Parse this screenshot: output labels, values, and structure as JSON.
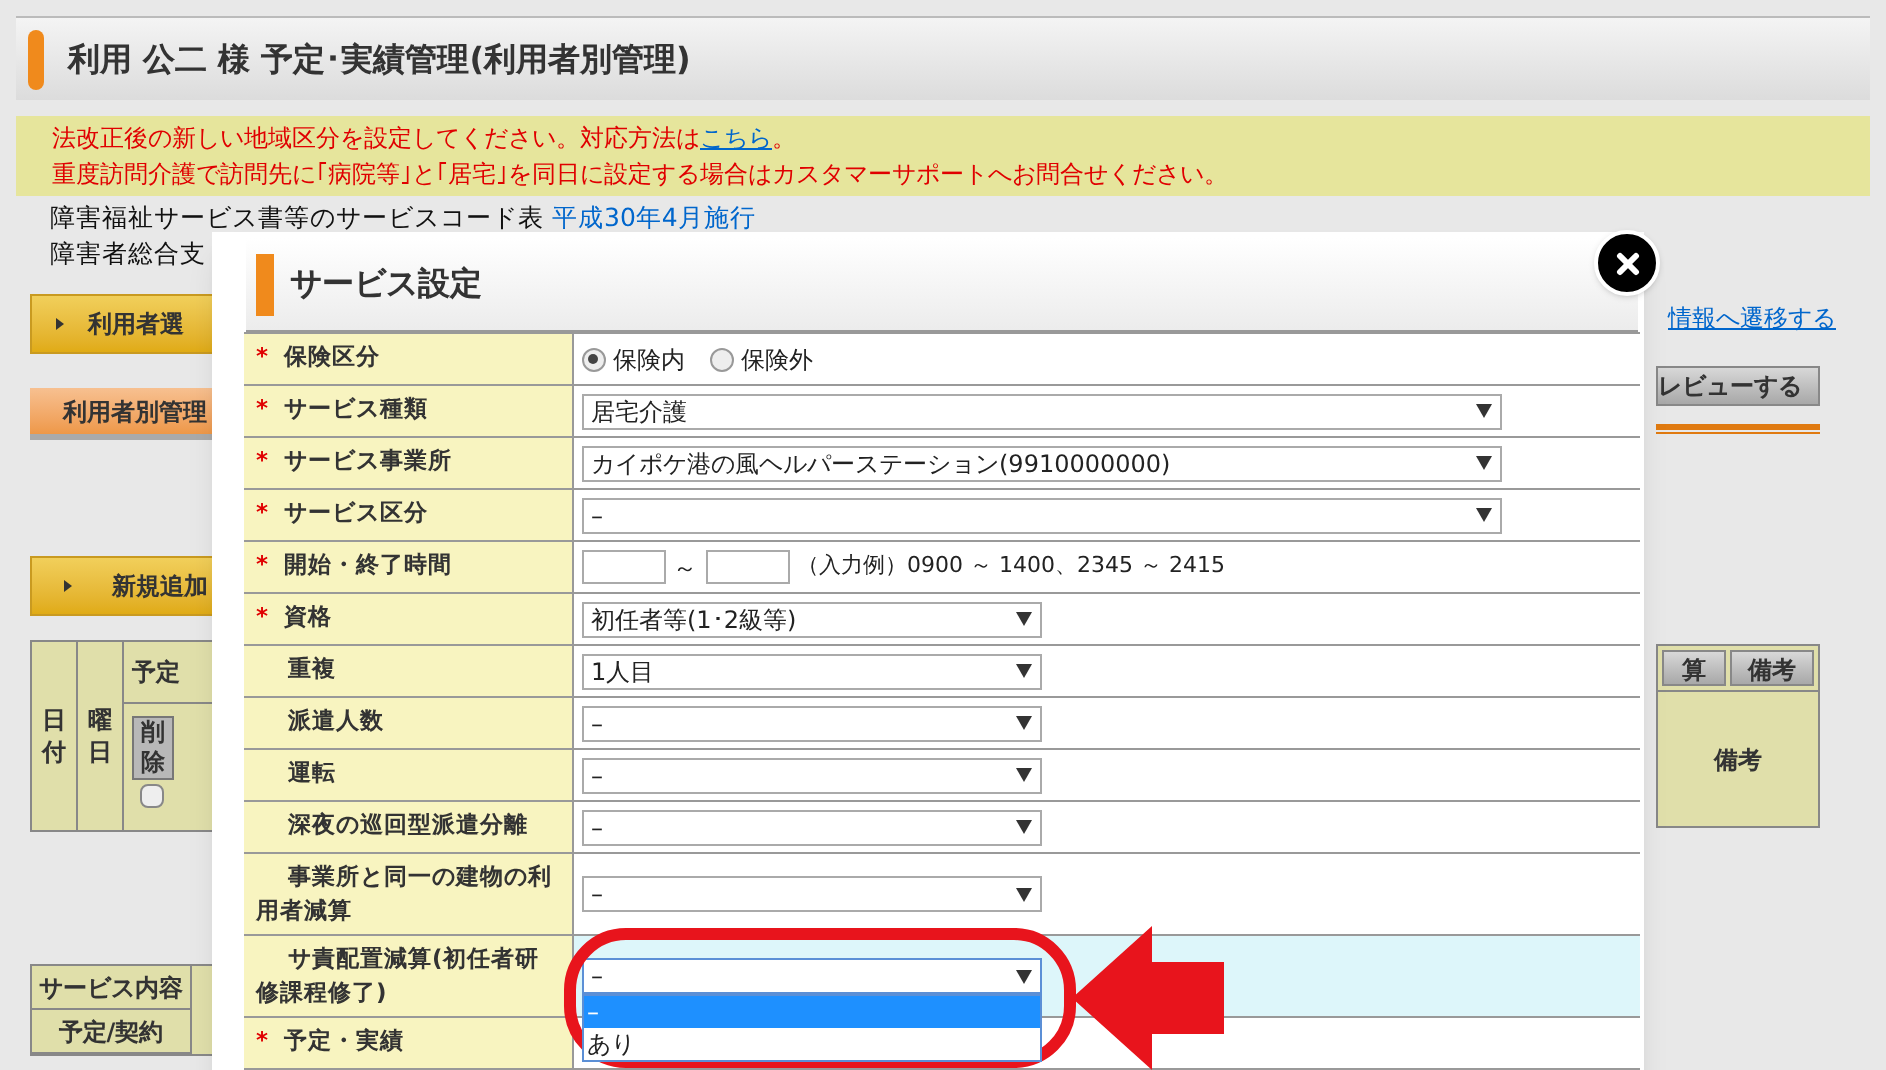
{
  "page_title": "利用 公二 様 予定･実績管理(利用者別管理)",
  "notice": {
    "line1_before": "法改正後の新しい地域区分を設定してください。対応方法は",
    "line1_link": "こちら",
    "line1_after": "。",
    "line2": "重度訪問介護で訪問先に｢病院等｣と｢居宅｣を同日に設定する場合はカスタマーサポートへお問合せください。"
  },
  "info_lines": [
    {
      "text": "障害福祉サービス書等のサービスコード表",
      "link": "平成30年4月施行"
    },
    {
      "text": "障害者総合支"
    }
  ],
  "left_buttons": {
    "user_select": "利用者選",
    "tab": "利用者別管理",
    "tab_selected": true,
    "new_add": "新規追加"
  },
  "right": {
    "link": "情報へ遷移する",
    "preview": "レビューする",
    "buttons": [
      "算",
      "備考"
    ],
    "cell": "備考"
  },
  "schedule_table": {
    "col_date": "日付",
    "col_weekday": "曜日",
    "col_plan": "予定",
    "delete": "削除",
    "checked": false
  },
  "bottom_table": [
    "サービス内容",
    "予定/契約"
  ],
  "modal": {
    "title": "サービス設定",
    "rows": [
      {
        "label": "保険区分",
        "mark": "*",
        "kind": "radio",
        "options": [
          {
            "label": "保険内",
            "selected": true
          },
          {
            "label": "保険外",
            "selected": false
          }
        ]
      },
      {
        "label": "サービス種類",
        "mark": "*",
        "kind": "select",
        "value": "居宅介護"
      },
      {
        "label": "サービス事業所",
        "mark": "*",
        "kind": "select",
        "value": "カイポケ港の風ヘルパーステーション(9910000000)"
      },
      {
        "label": "サービス区分",
        "mark": "*",
        "kind": "select",
        "value": "–"
      },
      {
        "label": "開始・終了時間",
        "mark": "*",
        "kind": "time",
        "separator": "～",
        "hint": "（入力例）0900 ～ 1400、2345 ～ 2415"
      },
      {
        "label": "資格",
        "mark": "*",
        "kind": "select",
        "value": "初任者等(1･2級等)"
      },
      {
        "label": "重複",
        "kind": "select",
        "value": "1人目"
      },
      {
        "label": "派遣人数",
        "kind": "select",
        "value": "–"
      },
      {
        "label": "運転",
        "kind": "select",
        "value": "–"
      },
      {
        "label": "深夜の巡回型派遣分離",
        "kind": "select",
        "value": "–"
      },
      {
        "label": "事業所と同一の建物の利用者減算",
        "kind": "select",
        "value": "–"
      },
      {
        "label": "サ責配置減算(初任者研修課程修了)",
        "kind": "open",
        "value": "–",
        "highlighted": true,
        "options": [
          {
            "label": "–",
            "selected": true
          },
          {
            "label": "あり",
            "selected": false
          }
        ]
      },
      {
        "label": "予定・実績",
        "mark": "*",
        "kind": "covered"
      }
    ]
  }
}
